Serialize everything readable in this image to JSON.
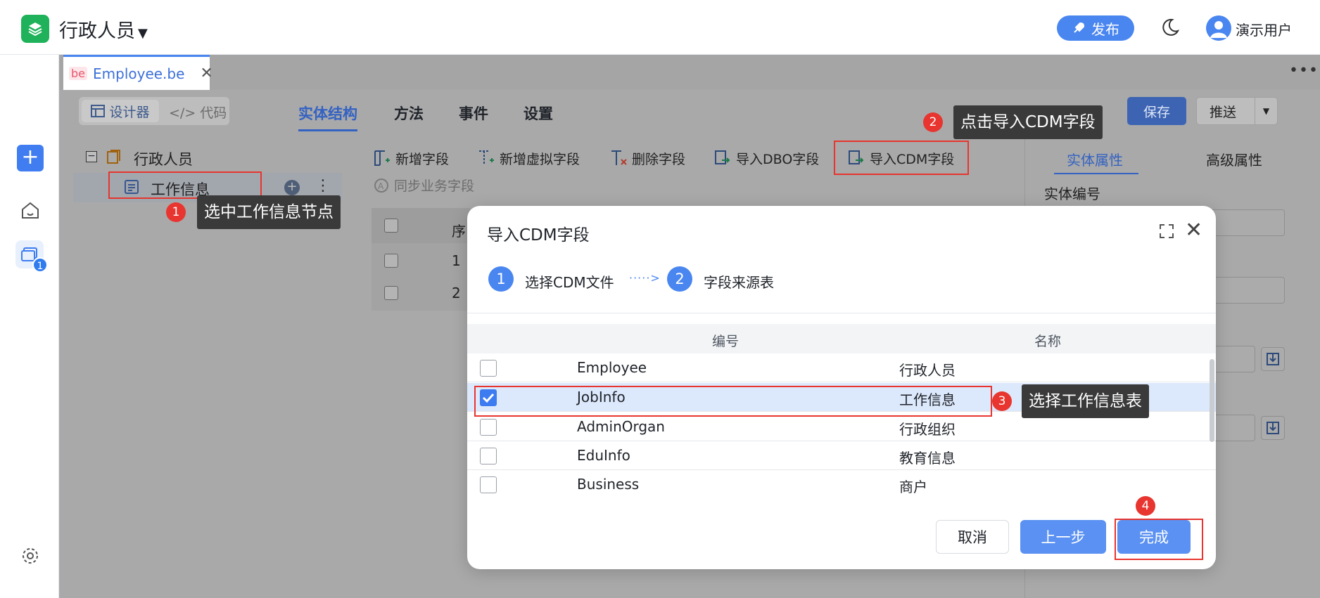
{
  "topbar": {
    "title": "行政人员",
    "publish_label": "发布",
    "user_name": "演示用户"
  },
  "file_tab": {
    "tag": "be",
    "name": "Employee.be"
  },
  "view_toggle": {
    "design": "设计器",
    "code": "代码"
  },
  "main_tabs": [
    {
      "label": "实体结构",
      "active": true
    },
    {
      "label": "方法",
      "active": false
    },
    {
      "label": "事件",
      "active": false
    },
    {
      "label": "设置",
      "active": false
    }
  ],
  "actions": {
    "save": "保存",
    "push": "推送"
  },
  "tree": {
    "root": "行政人员",
    "child": "工作信息"
  },
  "toolbar": {
    "add_field": "新增字段",
    "add_virtual": "新增虚拟字段",
    "delete_field": "删除字段",
    "import_dbo": "导入DBO字段",
    "import_cdm": "导入CDM字段",
    "sync": "同步业务字段"
  },
  "grid": {
    "col_seq": "序",
    "rows": [
      "1",
      "2"
    ]
  },
  "right_panel": {
    "tab_entity": "实体属性",
    "tab_advanced": "高级属性",
    "label_code": "实体编号"
  },
  "rail": {
    "badge": "1"
  },
  "modal": {
    "title": "导入CDM字段",
    "steps": [
      {
        "num": "1",
        "label": "选择CDM文件"
      },
      {
        "num": "2",
        "label": "字段来源表"
      }
    ],
    "step_arrow": "·····>",
    "columns": {
      "code": "编号",
      "name": "名称"
    },
    "rows": [
      {
        "code": "Employee",
        "name": "行政人员",
        "checked": false
      },
      {
        "code": "JobInfo",
        "name": "工作信息",
        "checked": true
      },
      {
        "code": "AdminOrgan",
        "name": "行政组织",
        "checked": false
      },
      {
        "code": "EduInfo",
        "name": "教育信息",
        "checked": false
      },
      {
        "code": "Business",
        "name": "商户",
        "checked": false
      }
    ],
    "buttons": {
      "cancel": "取消",
      "prev": "上一步",
      "done": "完成"
    }
  },
  "annotations": [
    {
      "num": "1",
      "text": "选中工作信息节点"
    },
    {
      "num": "2",
      "text": "点击导入CDM字段"
    },
    {
      "num": "3",
      "text": "选择工作信息表"
    },
    {
      "num": "4",
      "text": ""
    }
  ],
  "colors": {
    "accent": "#4a86f0",
    "annotation": "#e8352f",
    "logo": "#1fb25a"
  }
}
